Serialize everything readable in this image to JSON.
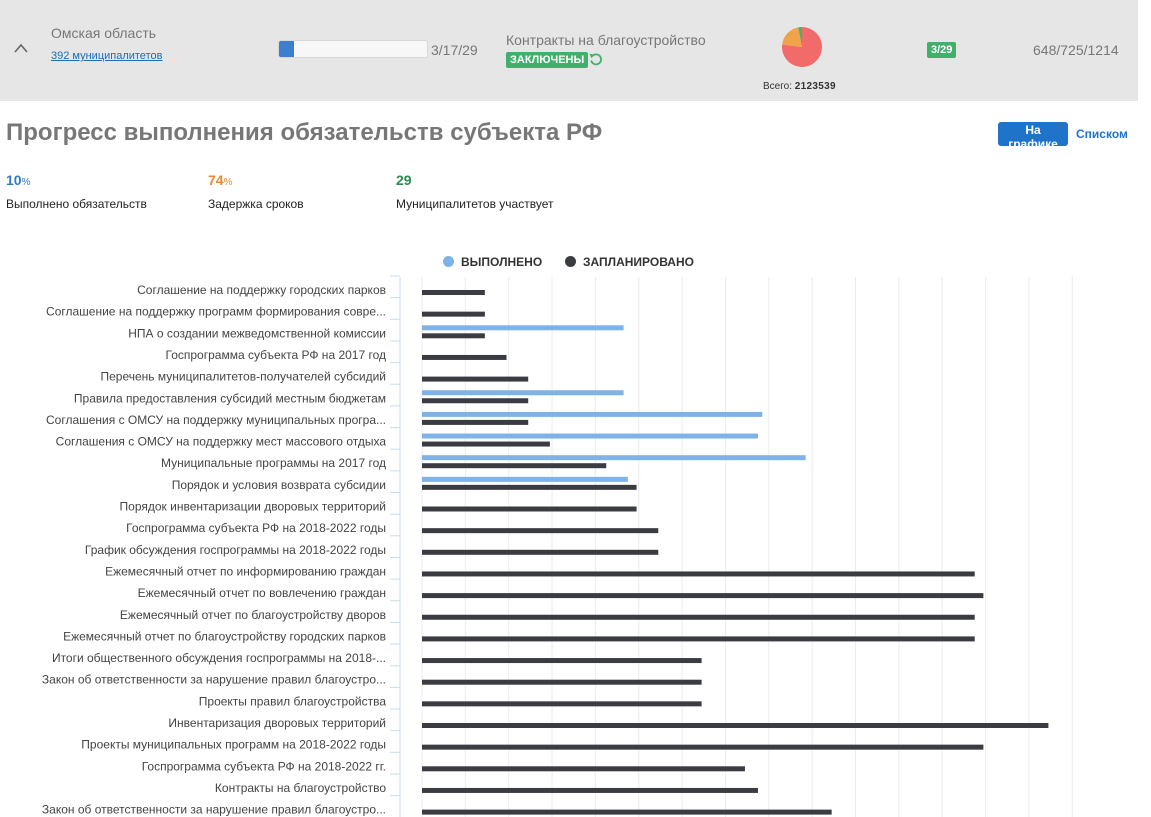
{
  "header": {
    "region_name": "Омская область",
    "municipalities_link": "392 муниципалитетов",
    "progress": {
      "done": 3,
      "total": 29,
      "text": "3/17/29"
    },
    "contracts_label": "Контракты на благоустройство",
    "contracts_status": "ЗАКЛЮЧЕНЫ",
    "pie": {
      "segments": [
        {
          "value": 0.77,
          "color": "#f26b6b"
        },
        {
          "value": 0.2,
          "color": "#f0a348"
        },
        {
          "value": 0.03,
          "color": "#4caf6a"
        }
      ]
    },
    "total_label": "Всего:",
    "total_value": "2123539",
    "count_badge": "3/29",
    "ratio": "648/725/1214"
  },
  "page": {
    "title": "Прогресс выполнения обязательств субъекта РФ",
    "view_graph": "На графике",
    "view_list": "Списком"
  },
  "stats": [
    {
      "value": "10",
      "suffix": "%",
      "label": "Выполнено обязательств",
      "color": "#2f7bc4"
    },
    {
      "value": "74",
      "suffix": "%",
      "label": "Задержка сроков",
      "color": "#e8892d"
    },
    {
      "value": "29",
      "suffix": "",
      "label": "Муниципалитетов участвует",
      "color": "#2a8a50"
    }
  ],
  "legend": {
    "done": {
      "label": "ВЫПОЛНЕНО",
      "color": "#7fb3e8"
    },
    "planned": {
      "label": "ЗАПЛАНИРОВАНО",
      "color": "#3a3c42"
    }
  },
  "chart_data": {
    "type": "bar",
    "orientation": "horizontal",
    "categories": [
      "Соглашение на поддержку городских парков",
      "Соглашение на поддержку программ формирования совре...",
      "НПА о создании межведомственной комиссии",
      "Госпрограмма субъекта РФ на 2017 год",
      "Перечень муниципалитетов-получателей субсидий",
      "Правила предоставления субсидий местным бюджетам",
      "Соглашения с ОМСУ на поддержку муниципальных програ...",
      "Соглашения с ОМСУ на поддержку мест массового отдыха",
      "Муниципальные программы на 2017 год",
      "Порядок и условия возврата субсидии",
      "Порядок инвентаризации дворовых территорий",
      "Госпрограмма субъекта РФ на 2018-2022 годы",
      "График обсуждения госпрограммы на 2018-2022 годы",
      "Ежемесячный отчет по информированию граждан",
      "Ежемесячный отчет по вовлечению граждан",
      "Ежемесячный отчет по благоустройству дворов",
      "Ежемесячный отчет по благоустройству городских парков",
      "Итоги общественного обсуждения госпрограммы на 2018-...",
      "Закон об ответственности за нарушение правил благоустро...",
      "Проекты правил благоустройства",
      "Инвентаризация дворовых территорий",
      "Проекты муниципальных программ на 2018-2022 годы",
      "Госпрограмма субъекта РФ на 2018-2022 гг.",
      "Контракты на благоустройство",
      "Закон об ответственности за нарушение правил благоустро..."
    ],
    "series": [
      {
        "name": "ВЫПОЛНЕНО",
        "color": "#7fb3e8",
        "values": [
          0,
          0,
          46.5,
          0,
          0,
          46.5,
          78.5,
          77.5,
          88.5,
          47.5,
          0,
          0,
          0,
          0,
          0,
          0,
          0,
          0,
          0,
          0,
          0,
          0,
          0,
          0,
          0
        ]
      },
      {
        "name": "ЗАПЛАНИРОВАНО",
        "color": "#3a3c42",
        "values": [
          14.5,
          14.5,
          14.5,
          19.5,
          24.5,
          24.5,
          24.5,
          29.5,
          42.5,
          49.5,
          49.5,
          54.5,
          54.5,
          127.5,
          129.5,
          127.5,
          127.5,
          64.5,
          64.5,
          64.5,
          144.5,
          129.5,
          74.5,
          77.5,
          94.5
        ]
      }
    ],
    "xlim": [
      0,
      155
    ],
    "grid": true,
    "legend_position": "top-center"
  }
}
